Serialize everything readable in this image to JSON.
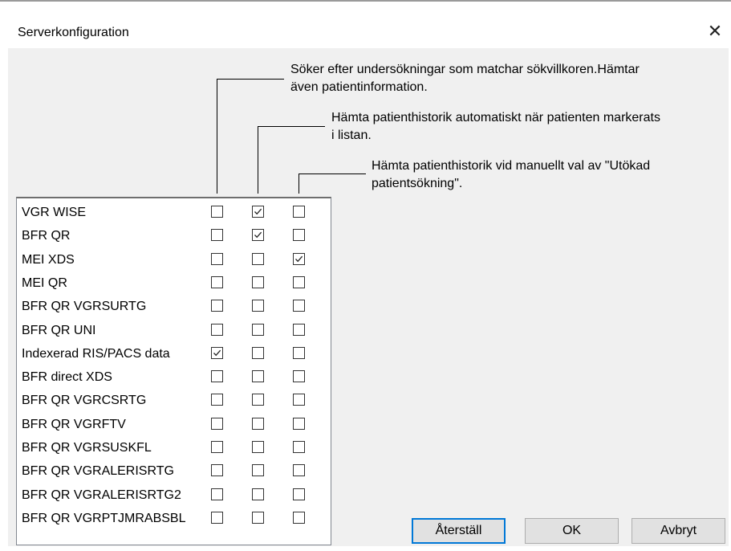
{
  "window": {
    "title": "Serverkonfiguration",
    "close_glyph": "✕"
  },
  "descriptions": [
    {
      "lines": [
        "Söker efter undersökningar som matchar sökvillkoren.Hämtar",
        "även patientinformation."
      ]
    },
    {
      "lines": [
        "Hämta patienthistorik automatiskt när patienten markerats",
        "i listan."
      ]
    },
    {
      "lines": [
        "Hämta patienthistorik vid manuellt val av \"Utökad",
        "patientsökning\"."
      ]
    }
  ],
  "servers": [
    {
      "name": "VGR WISE",
      "checks": [
        false,
        true,
        false
      ]
    },
    {
      "name": "BFR QR",
      "checks": [
        false,
        true,
        false
      ]
    },
    {
      "name": "MEI XDS",
      "checks": [
        false,
        false,
        true
      ]
    },
    {
      "name": "MEI QR",
      "checks": [
        false,
        false,
        false
      ]
    },
    {
      "name": "BFR QR VGRSURTG",
      "checks": [
        false,
        false,
        false
      ]
    },
    {
      "name": "BFR QR UNI",
      "checks": [
        false,
        false,
        false
      ]
    },
    {
      "name": "Indexerad RIS/PACS data",
      "checks": [
        true,
        false,
        false
      ]
    },
    {
      "name": "BFR direct XDS",
      "checks": [
        false,
        false,
        false
      ]
    },
    {
      "name": "BFR QR VGRCSRTG",
      "checks": [
        false,
        false,
        false
      ]
    },
    {
      "name": "BFR QR VGRFTV",
      "checks": [
        false,
        false,
        false
      ]
    },
    {
      "name": "BFR QR VGRSUSKFL",
      "checks": [
        false,
        false,
        false
      ]
    },
    {
      "name": "BFR QR VGRALERISRTG",
      "checks": [
        false,
        false,
        false
      ]
    },
    {
      "name": "BFR QR VGRALERISRTG2",
      "checks": [
        false,
        false,
        false
      ]
    },
    {
      "name": "BFR QR VGRPTJMRABSBL",
      "checks": [
        false,
        false,
        false
      ]
    }
  ],
  "buttons": {
    "reset": "Återställ",
    "ok": "OK",
    "cancel": "Avbryt"
  }
}
